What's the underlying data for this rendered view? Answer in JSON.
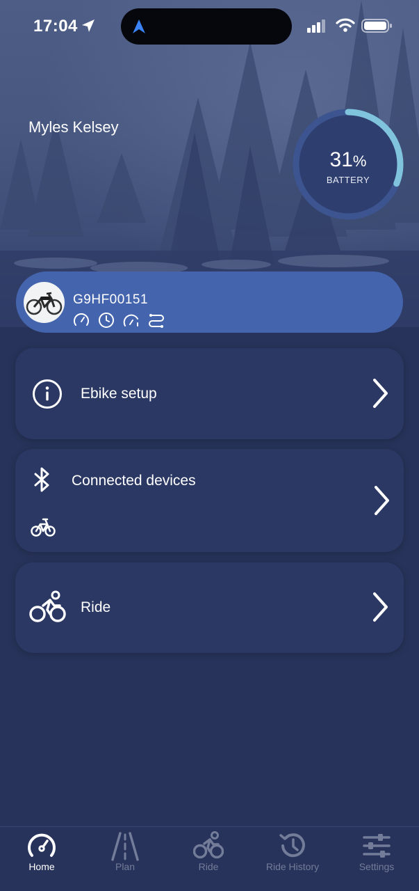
{
  "status_bar": {
    "time": "17:04"
  },
  "user": {
    "name": "Myles Kelsey"
  },
  "battery": {
    "percent_value": "31",
    "percent_unit": "%",
    "label": "BATTERY",
    "level": 0.31
  },
  "bike": {
    "id": "G9HF00151",
    "icons": [
      "speedometer-icon",
      "clock-icon",
      "gauge-icon",
      "route-icon"
    ]
  },
  "menu": {
    "ebike_setup": "Ebike setup",
    "connected_devices": "Connected devices",
    "ride": "Ride"
  },
  "tabs": [
    {
      "label": "Home",
      "icon": "speedometer-icon",
      "active": true
    },
    {
      "label": "Plan",
      "icon": "road-icon",
      "active": false
    },
    {
      "label": "Ride",
      "icon": "bike-icon",
      "active": false
    },
    {
      "label": "Ride History",
      "icon": "history-icon",
      "active": false
    },
    {
      "label": "Settings",
      "icon": "sliders-icon",
      "active": false
    }
  ],
  "colors": {
    "background": "#27335a",
    "card": "#2b3863",
    "bike_card": "#4465ae",
    "battery_arc": "#7fc3dc",
    "tab_inactive": "#737c99"
  }
}
